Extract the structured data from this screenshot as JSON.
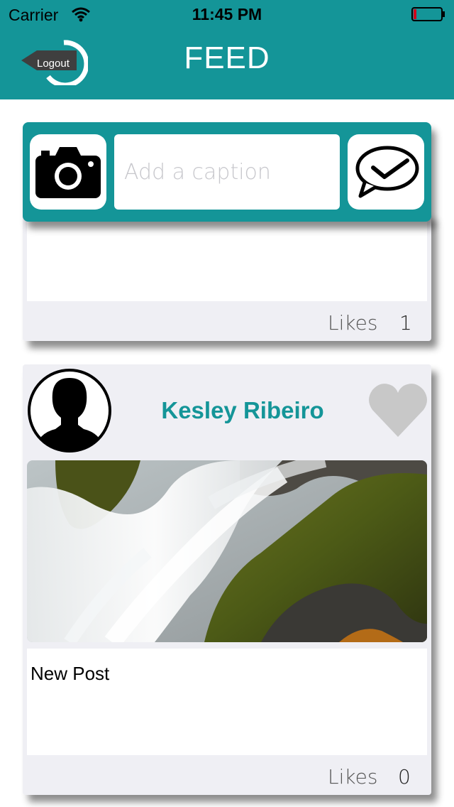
{
  "status_bar": {
    "carrier": "Carrier",
    "time": "11:45 PM",
    "wifi_icon": "wifi-icon",
    "battery_icon": "battery-low-icon"
  },
  "nav": {
    "title": "FEED",
    "logout_label": "Logout",
    "logout_icon": "logout-arrow-ring-icon"
  },
  "composer": {
    "camera_icon": "camera-icon",
    "caption_placeholder": "Add a caption",
    "caption_value": "",
    "send_icon": "chat-check-icon"
  },
  "posts": [
    {
      "likes_label": "Likes",
      "likes_count": "1"
    },
    {
      "author": "Kesley Ribeiro",
      "avatar_icon": "user-silhouette-icon",
      "like_icon": "heart-icon",
      "photo": "waterfall-mossy-rocks-image",
      "caption": "New Post",
      "likes_label": "Likes",
      "likes_count": "0"
    }
  ],
  "colors": {
    "accent": "#149598",
    "card_background": "#efeff4",
    "heart_inactive": "#c8c8c8"
  }
}
